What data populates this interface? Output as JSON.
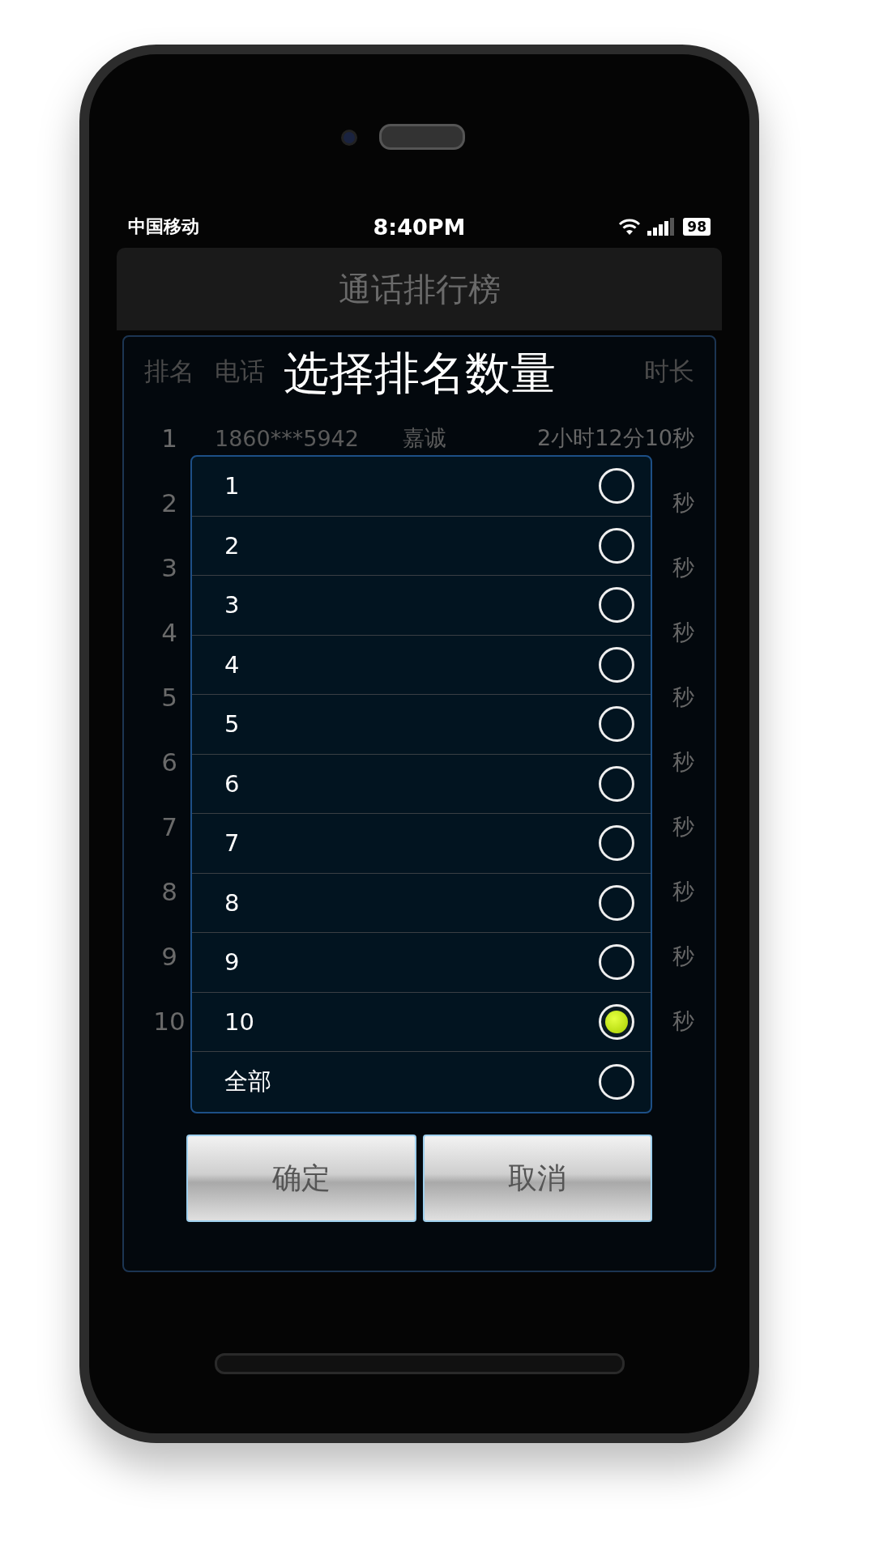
{
  "status_bar": {
    "carrier": "中国移动",
    "time": "8:40PM",
    "battery": "98"
  },
  "title": "通话排行榜",
  "table": {
    "columns": [
      "排名",
      "电话",
      "时长"
    ],
    "rows": [
      {
        "rank": "1",
        "phone": "1860***5942",
        "name": "嘉诚",
        "duration": "2小时12分10秒"
      },
      {
        "rank": "2",
        "duration": "秒"
      },
      {
        "rank": "3",
        "duration": "秒"
      },
      {
        "rank": "4",
        "duration": "秒"
      },
      {
        "rank": "5",
        "duration": "秒"
      },
      {
        "rank": "6",
        "duration": "秒"
      },
      {
        "rank": "7",
        "duration": "秒"
      },
      {
        "rank": "8",
        "duration": "秒"
      },
      {
        "rank": "9",
        "duration": "秒"
      },
      {
        "rank": "10",
        "duration": "秒"
      }
    ]
  },
  "dialog": {
    "title": "选择排名数量",
    "options": [
      {
        "label": "1",
        "selected": false
      },
      {
        "label": "2",
        "selected": false
      },
      {
        "label": "3",
        "selected": false
      },
      {
        "label": "4",
        "selected": false
      },
      {
        "label": "5",
        "selected": false
      },
      {
        "label": "6",
        "selected": false
      },
      {
        "label": "7",
        "selected": false
      },
      {
        "label": "8",
        "selected": false
      },
      {
        "label": "9",
        "selected": false
      },
      {
        "label": "10",
        "selected": true
      },
      {
        "label": "全部",
        "selected": false
      }
    ],
    "buttons": [
      "确定",
      "取消"
    ]
  }
}
